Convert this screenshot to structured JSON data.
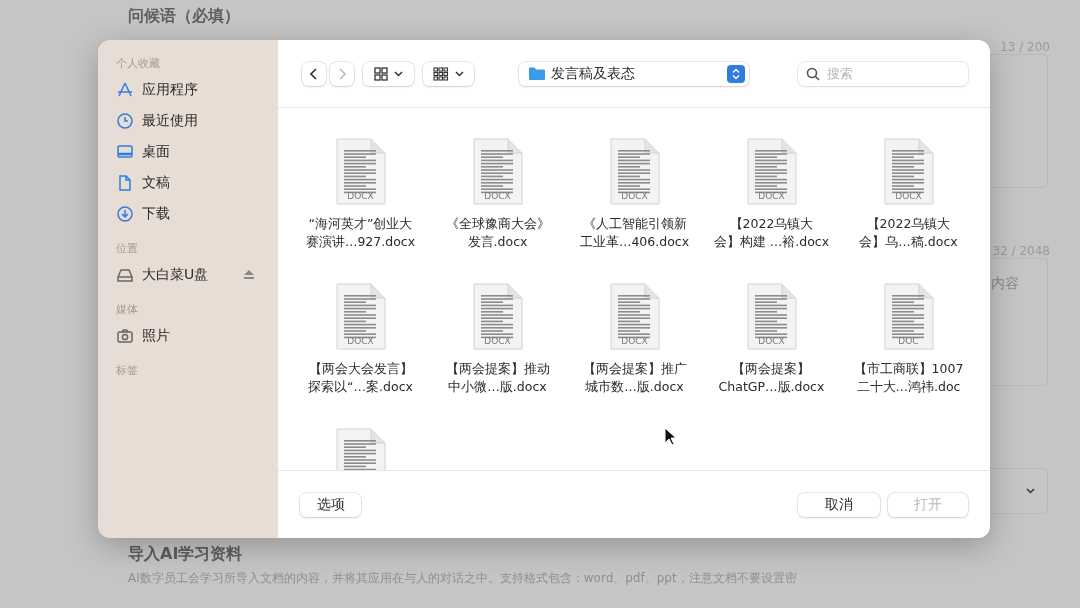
{
  "background_form": {
    "greeting_title": "问候语（必填）",
    "greeting_counter": "13 / 200",
    "content_counter": "32 / 2048",
    "content_text": "内容",
    "import_title": "导入AI学习资料",
    "import_description": "AI数字员工会学习所导入文档的内容，并将其应用在与人的对话之中。支持格式包含：word、pdf、ppt，注意文档不要设置密"
  },
  "dialog": {
    "sidebar": [
      {
        "heading": "个人收藏",
        "items": [
          {
            "label": "应用程序",
            "kind": "apps"
          },
          {
            "label": "最近使用",
            "kind": "clock"
          },
          {
            "label": "桌面",
            "kind": "desktop"
          },
          {
            "label": "文稿",
            "kind": "document"
          },
          {
            "label": "下载",
            "kind": "download"
          }
        ]
      },
      {
        "heading": "位置",
        "items": [
          {
            "label": "大白菜U盘",
            "kind": "drive",
            "ejectable": true
          }
        ]
      },
      {
        "heading": "媒体",
        "items": [
          {
            "label": "照片",
            "kind": "camera"
          }
        ]
      },
      {
        "heading": "标签"
      }
    ],
    "toolbar": {
      "back_disabled": false,
      "forward_disabled": true,
      "location": "发言稿及表态",
      "search_placeholder": "搜索"
    },
    "files": [
      {
        "kind": "page-thumbnail",
        "lines": [
          "“海河英才”创业大",
          "赛演讲…927.docx"
        ],
        "type_label": "DOCX"
      },
      {
        "kind": "page-thumbnail",
        "lines": [
          "《全球豫商大会》",
          "发言.docx"
        ],
        "type_label": "DOCX"
      },
      {
        "kind": "page-thumbnail",
        "lines": [
          "《人工智能引领新",
          "工业革…406.docx"
        ],
        "type_label": "DOCX"
      },
      {
        "kind": "page-thumbnail",
        "lines": [
          "【2022乌镇大",
          "会】构建 …裕.docx"
        ],
        "type_label": "DOCX"
      },
      {
        "kind": "page-thumbnail",
        "lines": [
          "【2022乌镇大",
          "会】乌…稿.docx"
        ],
        "type_label": "DOCX"
      },
      {
        "kind": "page-thumbnail",
        "lines": [
          "【两会大会发言】",
          "探索以“…案.docx"
        ],
        "type_label": "DOCX"
      },
      {
        "kind": "page-thumbnail",
        "lines": [
          "【两会提案】推动",
          "中小微…版.docx"
        ],
        "type_label": "DOCX"
      },
      {
        "kind": "page-thumbnail",
        "lines": [
          "【两会提案】推广",
          "城市数…版.docx"
        ],
        "type_label": "DOCX"
      },
      {
        "kind": "page-thumbnail",
        "lines": [
          "【两会提案】",
          "ChatGP…版.docx"
        ],
        "type_label": "DOCX"
      },
      {
        "kind": "page-thumbnail",
        "lines": [
          "【市工商联】1007",
          "二十大…鸿祎.doc"
        ],
        "type_label": "DOC"
      },
      {
        "kind": "page-thumbnail"
      }
    ],
    "footer": {
      "options": "选项",
      "cancel": "取消",
      "open": "打开",
      "open_disabled": true
    }
  }
}
